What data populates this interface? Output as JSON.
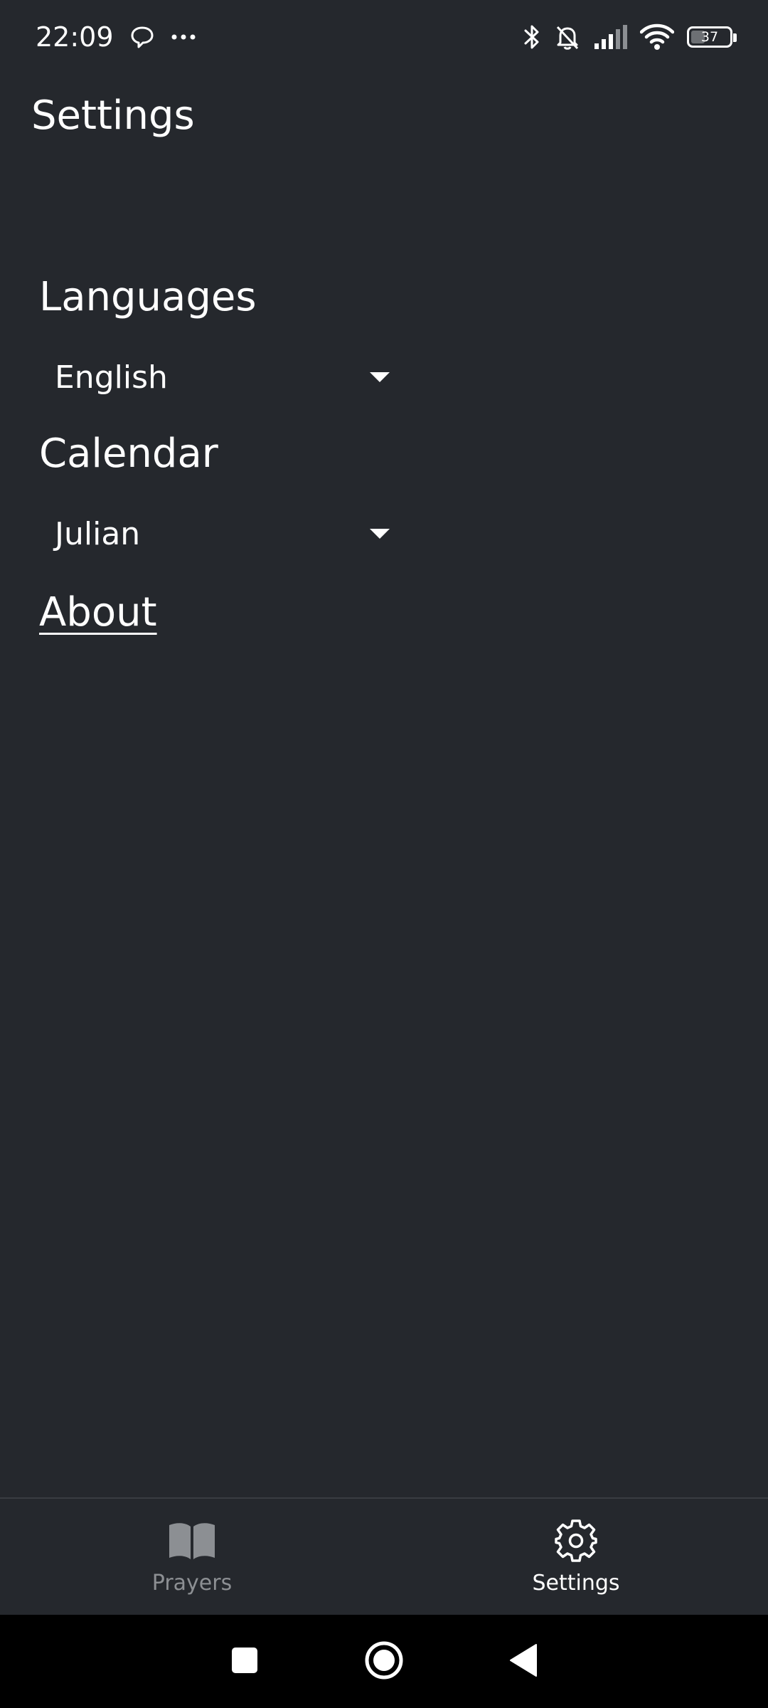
{
  "status_bar": {
    "time": "22:09",
    "battery": "37",
    "battery_level": 0.37,
    "icons": [
      "chat-bubble-icon",
      "more-dots-icon",
      "bluetooth-icon",
      "bell-muted-icon",
      "signal-icon",
      "wifi-icon",
      "battery-icon"
    ]
  },
  "header": {
    "title": "Settings"
  },
  "settings": {
    "languages_heading": "Languages",
    "language_value": "English",
    "calendar_heading": "Calendar",
    "calendar_value": "Julian",
    "about_link": "About"
  },
  "bottom_nav": {
    "items": [
      {
        "label": "Prayers",
        "icon": "book-icon",
        "active": false
      },
      {
        "label": "Settings",
        "icon": "gear-icon",
        "active": true
      }
    ]
  },
  "system_nav": {
    "buttons": [
      "recents-square-icon",
      "home-circle-icon",
      "back-triangle-icon"
    ]
  },
  "colors": {
    "background": "#25282d",
    "text": "#ffffff",
    "inactive": "#8c8f93",
    "system_bar": "#000000"
  }
}
